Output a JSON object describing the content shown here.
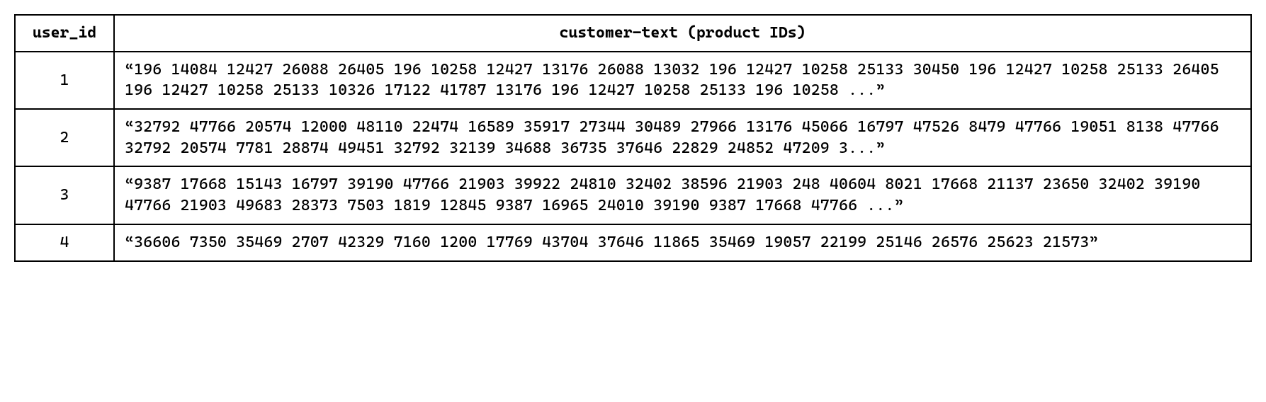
{
  "table": {
    "headers": {
      "user_id": "user_id",
      "customer_text": "customer-text (product IDs)"
    },
    "rows": [
      {
        "user_id": "1",
        "text": "“196 14084 12427 26088 26405 196 10258 12427 13176 26088 13032 196 12427 10258 25133 30450 196 12427 10258 25133 26405 196 12427 10258 25133 10326 17122 41787 13176 196 12427 10258 25133 196 10258 ...”"
      },
      {
        "user_id": "2",
        "text": "“32792 47766 20574 12000 48110 22474 16589 35917 27344 30489 27966 13176 45066 16797 47526 8479 47766 19051 8138 47766 32792 20574 7781 28874 49451 32792 32139 34688 36735 37646 22829 24852 47209 3...”"
      },
      {
        "user_id": "3",
        "text": "“9387 17668 15143 16797 39190 47766 21903 39922 24810 32402 38596 21903 248 40604 8021 17668 21137 23650 32402 39190 47766 21903 49683 28373 7503 1819 12845 9387 16965 24010 39190 9387 17668 47766 ...”"
      },
      {
        "user_id": "4",
        "text": "“36606 7350 35469 2707 42329 7160 1200 17769 43704 37646 11865 35469 19057 22199 25146 26576 25623 21573”"
      }
    ]
  }
}
